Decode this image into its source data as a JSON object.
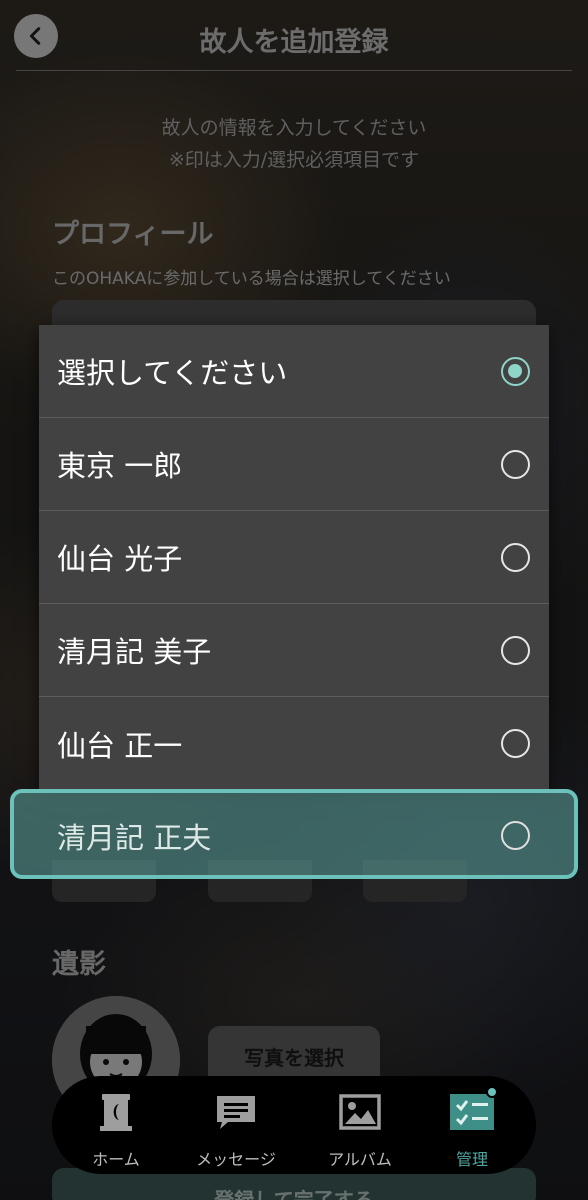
{
  "header": {
    "title": "故人を追加登録",
    "back_icon": "chevron-left-icon"
  },
  "intro": {
    "line1": "故人の情報を入力してください",
    "line2": "※印は入力/選択必須項目です"
  },
  "profile": {
    "section_title": "プロフィール",
    "hint": "このOHAKAに参加している場合は選択してください"
  },
  "portrait": {
    "section_title": "遺影",
    "select_photo_label": "写真を選択"
  },
  "submit_label": "登録して完了する",
  "dropdown": {
    "options": [
      {
        "label": "選択してください",
        "selected": true
      },
      {
        "label": "東京 一郎",
        "selected": false
      },
      {
        "label": "仙台 光子",
        "selected": false
      },
      {
        "label": "清月記 美子",
        "selected": false
      },
      {
        "label": "仙台 正一",
        "selected": false
      },
      {
        "label": "清月記 正夫",
        "selected": false
      }
    ],
    "accent_color": "#8fd3c9"
  },
  "nav": {
    "items": [
      {
        "label": "ホーム",
        "icon": "home-grave-icon"
      },
      {
        "label": "メッセージ",
        "icon": "message-icon"
      },
      {
        "label": "アルバム",
        "icon": "album-icon"
      },
      {
        "label": "管理",
        "icon": "manage-checklist-icon",
        "active": true
      }
    ],
    "active_color": "#4fa8a0"
  }
}
